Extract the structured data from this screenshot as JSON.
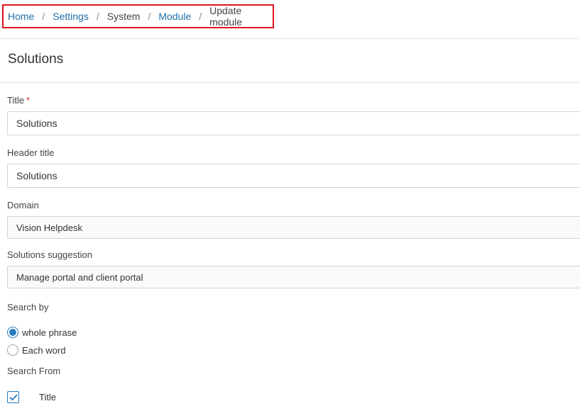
{
  "breadcrumb": {
    "items": [
      {
        "label": "Home",
        "link": true
      },
      {
        "label": "Settings",
        "link": true
      },
      {
        "label": "System",
        "link": false
      },
      {
        "label": "Module",
        "link": true
      },
      {
        "label": "Update module",
        "link": false
      }
    ],
    "separator": "/"
  },
  "section": {
    "title": "Solutions"
  },
  "form": {
    "title": {
      "label": "Title",
      "required_mark": "*",
      "value": "Solutions"
    },
    "header_title": {
      "label": "Header title",
      "value": "Solutions"
    },
    "domain": {
      "label": "Domain",
      "value": "Vision Helpdesk"
    },
    "solutions_suggestion": {
      "label": "Solutions suggestion",
      "value": "Manage portal and client portal"
    },
    "search_by": {
      "label": "Search by",
      "options": [
        {
          "label": "whole phrase",
          "checked": true
        },
        {
          "label": "Each word",
          "checked": false
        }
      ]
    },
    "search_from": {
      "label": "Search From",
      "options": [
        {
          "label": "Title",
          "checked": true
        }
      ]
    }
  },
  "colors": {
    "link": "#1f6fa8",
    "accent": "#2a7bbf",
    "highlight_box": "#e0141e",
    "required": "#d0202e"
  }
}
